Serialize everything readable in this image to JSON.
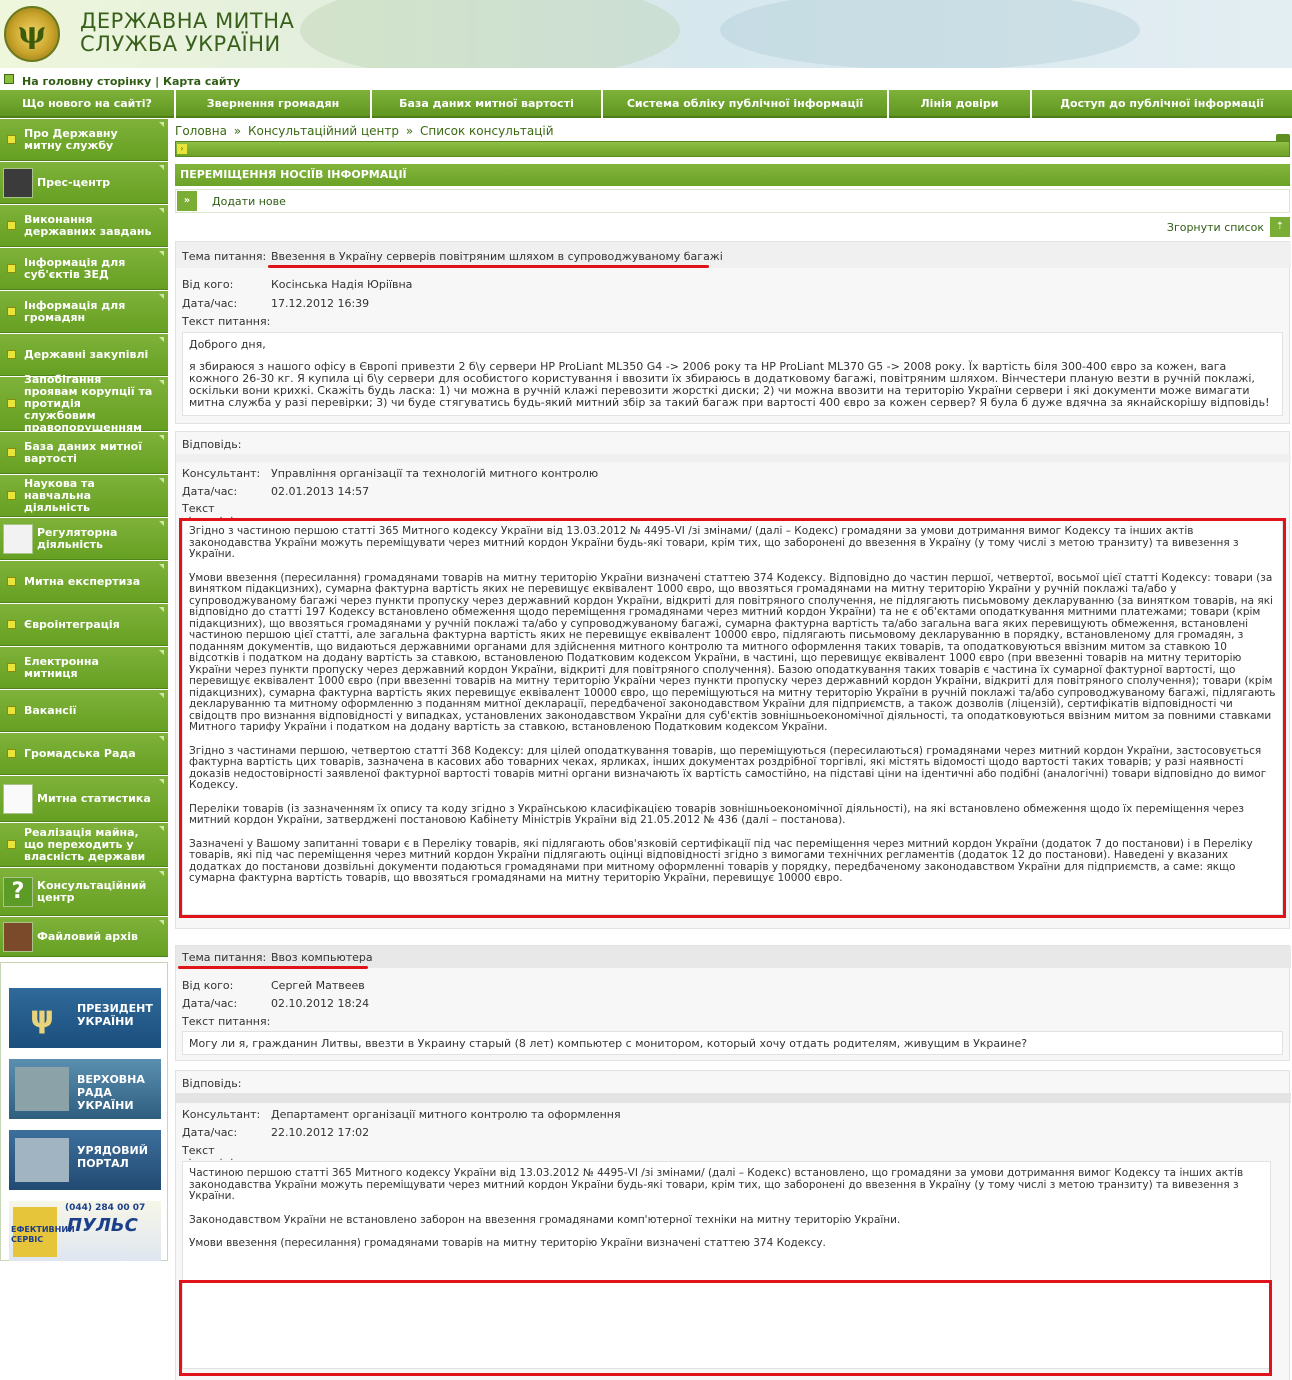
{
  "header": {
    "title_line1": "ДЕРЖАВНА МИТНА",
    "title_line2": "СЛУЖБА УКРАЇНИ",
    "emblem_icon": "customs-emblem"
  },
  "topbar": {
    "home_link": "На головну сторінку",
    "separator": "|",
    "sitemap_link": "Карта сайту"
  },
  "mainnav": [
    "Що нового на сайті?",
    "Звернення громадян",
    "База даних митної вартості",
    "Система обліку публічної інформації",
    "Лінія довіри",
    "Доступ до публічної інформації"
  ],
  "sidebar": [
    "Про Державну митну службу",
    "Прес-центр",
    "Виконання державних завдань",
    "Інформація для суб'єктів ЗЕД",
    "Інформація для громадян",
    "Державні закупівлі",
    "Запобігання проявам корупції та протидія службовим правопорушенням",
    "База даних митної вартості",
    "Наукова та навчальна діяльність",
    "Регуляторна діяльність",
    "Митна експертиза",
    "Євроінтеграція",
    "Електронна митниця",
    "Вакансії",
    "Громадська Рада",
    "Митна статистика",
    "Реалізація майна, що переходить у власність держави",
    "Консультаційний центр",
    "Файловий архів"
  ],
  "banners": {
    "president": "ПРЕЗИДЕНТ УКРАЇНИ",
    "rada": "ВЕРХОВНА РАДА УКРАЇНИ",
    "portal": "УРЯДОВИЙ ПОРТАЛ",
    "puls": "ПУЛЬС",
    "puls_phone": "(044) 284 00 07",
    "puls_left": "ЕФЕКТИВНИЙ СЕРВІС"
  },
  "breadcrumb": {
    "home": "Головна",
    "sep": "»",
    "center": "Консультаційний центр",
    "list": "Список консультацій"
  },
  "section_title": "ПЕРЕМІЩЕННЯ НОСІЇВ ІНФОРМАЦІЇ",
  "add_new": "Додати нове",
  "collapse_list": "Згорнути список",
  "labels": {
    "topic": "Тема питання:",
    "from": "Від кого:",
    "datetime": "Дата/час:",
    "question_text": "Текст питання:",
    "answer": "Відповідь:",
    "consultant": "Консультант:",
    "answer_text": "Текст відповіді:"
  },
  "consultations": [
    {
      "topic": "Ввезення в Україну серверів повітряним шляхом в супроводжуваному багажі",
      "from": "Косінська Надія Юріївна",
      "date": "17.12.2012 16:39",
      "question": [
        "Доброго дня,",
        "я збираюся з нашого офісу в Європі привезти 2 б\\у сервери HP ProLiant ML350 G4 -> 2006 року та HP ProLiant ML370 G5 -> 2008 року. Їх вартість біля 300-400 євро за кожен, вага кожного 26-30 кг. Я купила ці б\\у сервери для особистого користування і ввозити їх збираюсь в додатковому багажі, повітряним шляхом. Вінчестери планую везти в ручній поклажі, оскільки вони крихкі. Скажіть будь ласка: 1) чи можна в ручній клажі перевозити жорсткі диски; 2) чи можна ввозити на територію України сервери і які документи може вимагати митна служба у разі перевірки; 3) чи буде стягуватись будь-який митний збір за такий багаж при вартості 400 євро за кожен сервер? Я була б дуже вдячна за якнайскорішу відповідь!"
      ],
      "consultant": "Управління організації та технологій митного контролю",
      "answer_date": "02.01.2013 14:57",
      "answer": [
        "Згідно з частиною першою статті 365 Митного кодексу України від 13.03.2012 № 4495-VI /зі змінами/ (далі – Кодекс) громадяни за умови дотримання вимог Кодексу та інших актів законодавства України можуть переміщувати через митний кордон України будь-які товари, крім тих, що заборонені до ввезення в Україну (у тому числі з метою транзиту) та вивезення з України.",
        "Умови ввезення (пересилання) громадянами товарів на митну територію України визначені статтею 374 Кодексу. Відповідно до частин першої, четвертої, восьмої цієї статті Кодексу: товари (за винятком підакцизних), сумарна фактурна вартість яких не перевищує еквівалент 1000 євро, що ввозяться громадянами на митну територію України у ручній поклажі та/або у супроводжуваному багажі через пункти пропуску через державний кордон України, відкриті для повітряного сполучення, не підлягають письмовому декларуванню (за винятком товарів, на які відповідно до статті 197 Кодексу встановлено обмеження щодо переміщення громадянами через митний кордон України) та не є об'єктами оподаткування митними платежами; товари (крім підакцизних), що ввозяться громадянами у ручній поклажі та/або у супроводжуваному багажі, сумарна фактурна вартість та/або загальна вага яких перевищують обмеження, встановлені частиною першою цієї статті, але загальна фактурна вартість яких не перевищує еквівалент 10000 євро, підлягають письмовому декларуванню в порядку, встановленому для громадян, з поданням документів, що видаються державними органами для здійснення митного контролю та митного оформлення таких товарів, та оподатковуються ввізним митом за ставкою 10 відсотків і податком на додану вартість за ставкою, встановленою Податковим кодексом України, в частині, що перевищує еквівалент 1000 євро (при ввезенні товарів на митну територію України через пункти пропуску через державний кордон України, відкриті для повітряного сполучення). Базою оподаткування таких товарів є частина їх сумарної фактурної вартості, що перевищує еквівалент 1000 євро (при ввезенні товарів на митну територію України через пункти пропуску через державний кордон України, відкриті для повітряного сполучення); товари (крім підакцизних), сумарна фактурна вартість яких перевищує еквівалент 10000 євро, що переміщуються на митну територію України в ручній поклажі та/або супроводжуваному багажі, підлягають декларуванню та митному оформленню з поданням митної декларації, передбаченої законодавством України для підприємств, а також дозволів (ліцензій), сертифікатів відповідності чи свідоцтв про визнання відповідності у випадках, установлених законодавством України для суб'єктів зовнішньоекономічної діяльності, та оподатковуються ввізним митом за повними ставками Митного тарифу України і податком на додану вартість за ставкою, встановленою Податковим кодексом України.",
        "Згідно з частинами першою, четвертою статті 368 Кодексу: для цілей оподаткування товарів, що переміщуються (пересилаються) громадянами через митний кордон України, застосовується фактурна вартість цих товарів, зазначена в касових або товарних чеках, ярликах, інших документах роздрібної торгівлі, які містять відомості щодо вартості таких товарів; у разі наявності доказів недостовірності заявленої фактурної вартості товарів митні органи визначають їх вартість самостійно, на підставі ціни на ідентичні або подібні (аналогічні) товари відповідно до вимог Кодексу.",
        "Переліки товарів (із зазначенням їх опису та коду згідно з Українською класифікацією товарів зовнішньоекономічної діяльності), на які встановлено обмеження щодо їх переміщення через митний кордон України, затверджені постановою Кабінету Міністрів України від 21.05.2012 № 436 (далі – постанова).",
        "Зазначені у Вашому запитанні товари є в Переліку товарів, які підлягають обов'язковій сертифікації під час переміщення через митний кордон України (додаток 7 до постанови) і в Переліку товарів, які під час переміщення через митний кордон України підлягають оцінці відповідності згідно з вимогами технічних регламентів (додаток 12 до постанови). Наведені у вказаних додатках до постанови дозвільні документи подаються громадянами при митному оформленні товарів у порядку, передбаченому законодавством України для підприємств, а саме: якщо сумарна фактурна вартість товарів, що ввозяться громадянами на митну територію України, перевищує 10000 євро."
      ]
    },
    {
      "topic": "Ввоз компьютера",
      "from": "Сергей Матвеев",
      "date": "02.10.2012 18:24",
      "question": [
        "Могу ли я, гражданин Литвы, ввезти в Украину старый (8 лет) компьютер с монитором, который хочу отдать родителям, живущим в Украине?"
      ],
      "consultant": "Департамент організації митного контролю та оформлення",
      "answer_date": "22.10.2012 17:02",
      "answer": [
        "Частиною першою статті 365 Митного кодексу України від 13.03.2012 № 4495-VI /зі змінами/ (далі – Кодекс) встановлено, що громадяни за умови дотримання вимог Кодексу та інших актів законодавства України можуть переміщувати через митний кордон України будь-які товари, крім тих, що заборонені до ввезення в Україну (у тому числі з метою транзиту) та вивезення з України.",
        "Законодавством України не встановлено заборон на ввезення громадянами комп'ютерної техніки на митну територію України.",
        "Умови ввезення (пересилання) громадянами товарів на митну територію України визначені статтею 374 Кодексу."
      ]
    }
  ]
}
